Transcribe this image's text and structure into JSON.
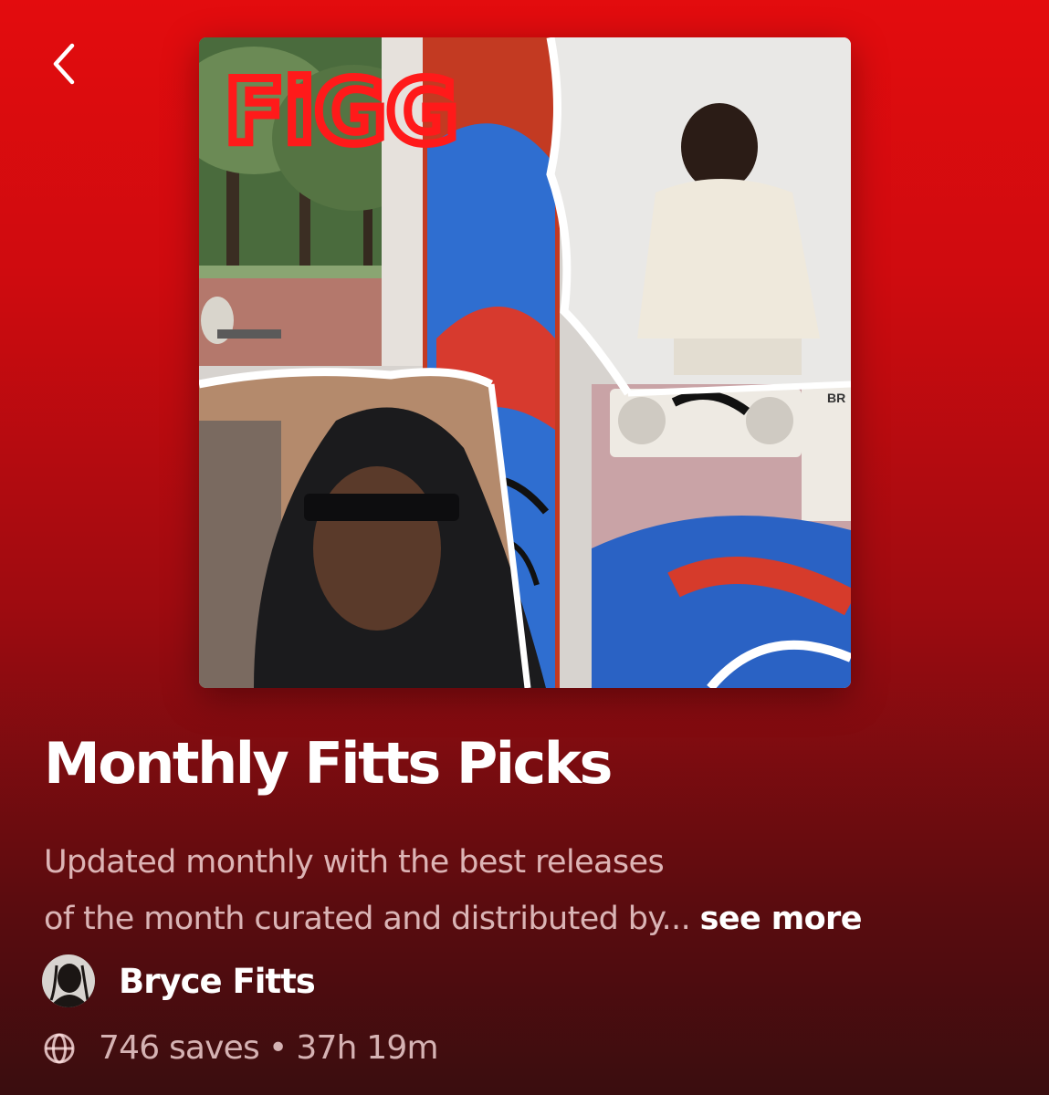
{
  "header": {
    "back_icon": "chevron-left-icon"
  },
  "cover": {
    "alt": "Playlist cover collage",
    "graffiti_text": "FiGG",
    "corner_text": "BR"
  },
  "playlist": {
    "title": "Monthly Fitts Picks",
    "description_line1": "Updated monthly with the best releases",
    "description_line2": "of the month curated and distributed by...",
    "see_more_label": "see more"
  },
  "owner": {
    "name": "Bryce Fitts"
  },
  "meta": {
    "visibility_icon": "globe-icon",
    "saves": "746 saves",
    "separator": "•",
    "duration": "37h 19m"
  },
  "colors": {
    "background_top": "#e30c0e",
    "background_bottom": "#3a0d0f",
    "text_primary": "#ffffff"
  }
}
